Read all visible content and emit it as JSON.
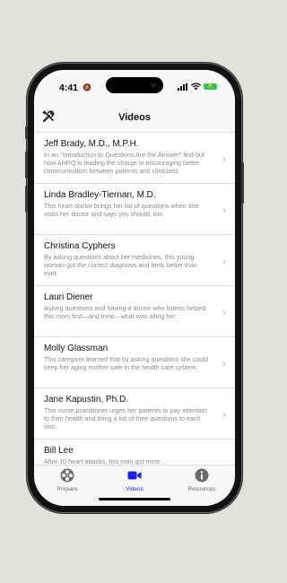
{
  "status_bar": {
    "time": "4:41"
  },
  "nav": {
    "title": "Videos"
  },
  "videos": [
    {
      "name": "Jeff Brady, M.D., M.P.H.",
      "description": "In an \"Introduction to Questions Are the Answer\" find out how AHRQ is leading the charge in encouraging better communication between patients and clinicians."
    },
    {
      "name": "Linda Bradley-Tiernan, M.D.",
      "description": "This heart doctor brings her list of questions when she visits her doctor and says you should, too."
    },
    {
      "name": "Christina Cyphers",
      "description": "By asking questions about her medicines, this young woman got the correct diagnosis and feels better than ever."
    },
    {
      "name": "Lauri Diener",
      "description": "Asking questions and having a doctor who listens helped this mom find—and treat—what was ailing her."
    },
    {
      "name": "Molly Glassman",
      "description": "This caregiver learned that by asking questions she could keep her aging mother safe in the health care system."
    },
    {
      "name": "Jane Kapustin, Ph.D.",
      "description": "This nurse practitioner urges her patients to pay attention to their health and bring a list of their questions to each visit."
    },
    {
      "name": "Bill Lee",
      "description": "After 10 heart attacks, this man got more"
    }
  ],
  "tabs": [
    {
      "label": "Prepare",
      "icon": "film-reel-icon"
    },
    {
      "label": "Videos",
      "icon": "video-camera-icon"
    },
    {
      "label": "Resources",
      "icon": "info-icon"
    }
  ],
  "active_tab": "Videos",
  "colors": {
    "accent": "#1a25e8",
    "battery": "#34c759"
  }
}
